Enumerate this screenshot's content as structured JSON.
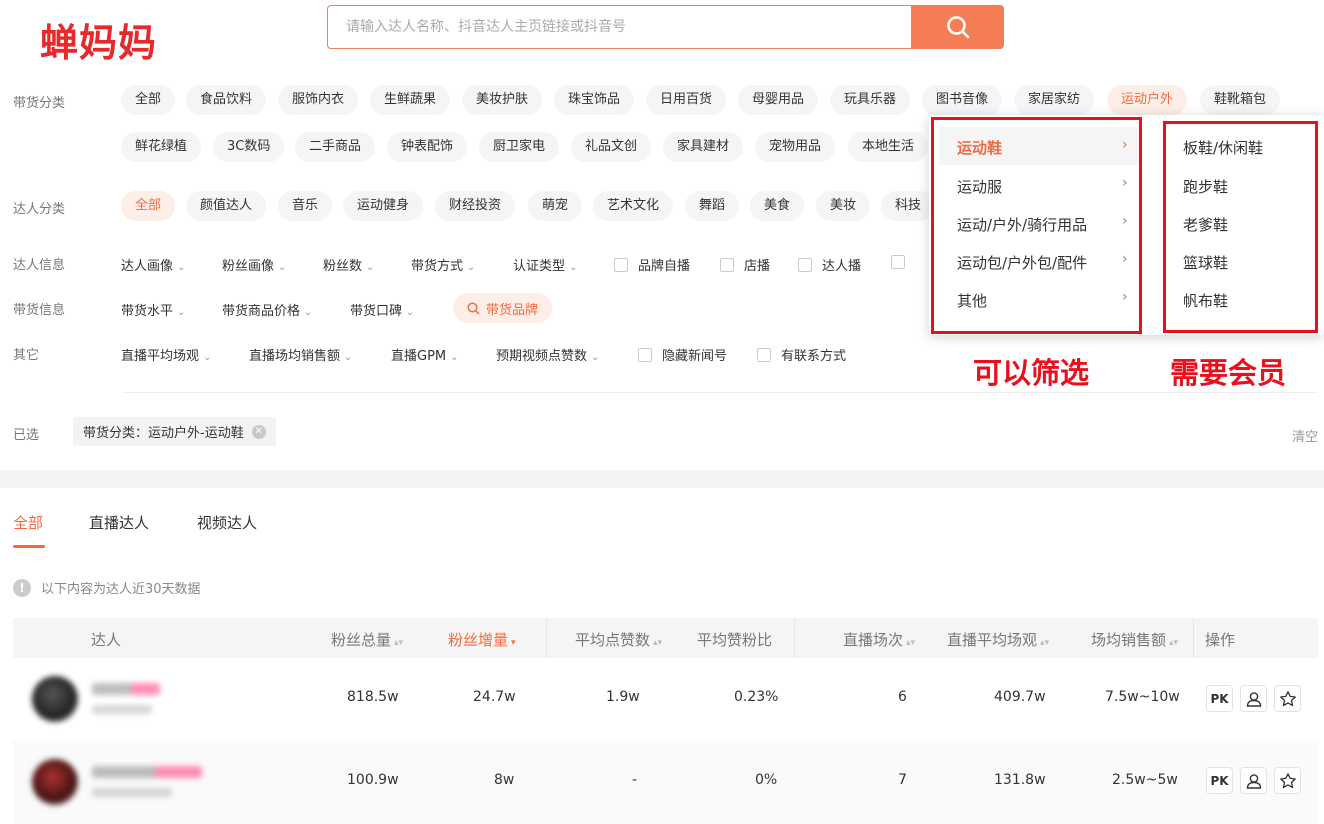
{
  "logo_text": "蝉妈妈",
  "search": {
    "placeholder": "请输入达人名称、抖音达人主页链接或抖音号"
  },
  "filters": {
    "category_label": "带货分类",
    "categories_row1": [
      "全部",
      "食品饮料",
      "服饰内衣",
      "生鲜蔬果",
      "美妆护肤",
      "珠宝饰品",
      "日用百货",
      "母婴用品",
      "玩具乐器",
      "图书音像",
      "家居家纺",
      "运动户外",
      "鞋靴箱包"
    ],
    "categories_row2": [
      "鲜花绿植",
      "3C数码",
      "二手商品",
      "钟表配饰",
      "厨卫家电",
      "礼品文创",
      "家具建材",
      "宠物用品",
      "本地生活"
    ],
    "category_active": "运动户外",
    "talent_label": "达人分类",
    "talent_types": [
      "全部",
      "颜值达人",
      "音乐",
      "运动健身",
      "财经投资",
      "萌宠",
      "艺术文化",
      "舞蹈",
      "美食",
      "美妆",
      "科技"
    ],
    "talent_active": "全部",
    "info_label": "达人信息",
    "info_dropdowns": [
      "达人画像",
      "粉丝画像",
      "粉丝数",
      "带货方式",
      "认证类型"
    ],
    "info_checks": [
      "品牌自播",
      "店播",
      "达人播"
    ],
    "goods_label": "带货信息",
    "goods_dropdowns": [
      "带货水平",
      "带货商品价格",
      "带货口碑"
    ],
    "brand_button": "带货品牌",
    "other_label": "其它",
    "other_dropdowns": [
      "直播平均场观",
      "直播场均销售额",
      "直播GPM",
      "预期视频点赞数"
    ],
    "other_checks": [
      "隐藏新闻号",
      "有联系方式"
    ],
    "selected_label": "已选",
    "selected_tag": "带货分类：运动户外-运动鞋",
    "clear": "清空"
  },
  "tabs": [
    "全部",
    "直播达人",
    "视频达人"
  ],
  "note": "以下内容为达人近30天数据",
  "table": {
    "headers": [
      "达人",
      "粉丝总量",
      "粉丝增量",
      "平均点赞数",
      "平均赞粉比",
      "直播场次",
      "直播平均场观",
      "场均销售额",
      "操作"
    ],
    "rows": [
      {
        "fans": "818.5w",
        "growth": "24.7w",
        "likes": "1.9w",
        "ratio": "0.23%",
        "lives": "6",
        "avg_view": "409.7w",
        "sales": "7.5w~10w"
      },
      {
        "fans": "100.9w",
        "growth": "8w",
        "likes": "-",
        "ratio": "0%",
        "lives": "7",
        "avg_view": "131.8w",
        "sales": "2.5w~5w"
      }
    ],
    "op_pk": "PK"
  },
  "dropdown_menu": {
    "items": [
      "运动鞋",
      "运动服",
      "运动/户外/骑行用品",
      "运动包/户外包/配件",
      "其他"
    ],
    "active": "运动鞋",
    "subitems": [
      "板鞋/休闲鞋",
      "跑步鞋",
      "老爹鞋",
      "篮球鞋",
      "帆布鞋"
    ]
  },
  "annotations": {
    "left": "可以筛选",
    "right": "需要会员"
  },
  "colors": {
    "accent": "#f26b40",
    "annotation_red": "#e8101c"
  }
}
